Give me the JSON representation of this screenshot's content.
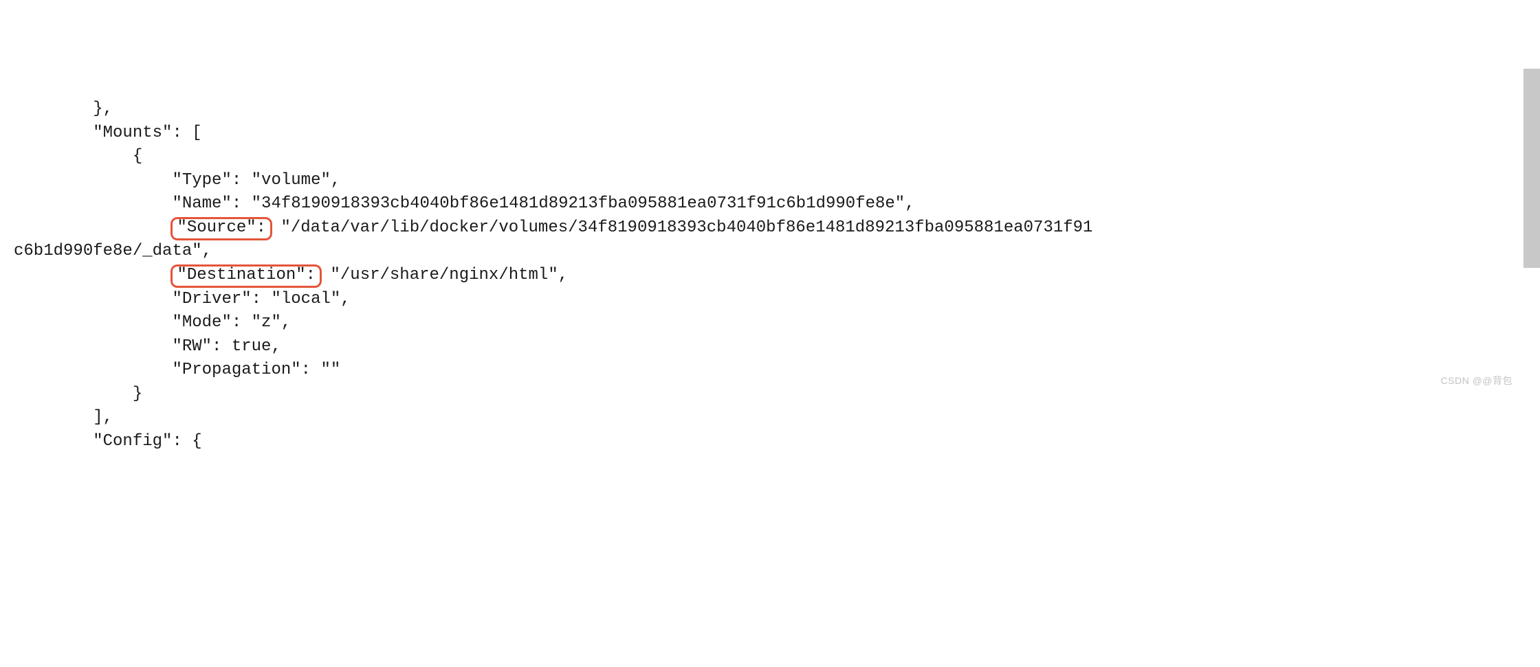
{
  "code": {
    "l1": "        },",
    "l2": "        \"Mounts\": [",
    "l3": "            {",
    "l4": "                \"Type\": \"volume\",",
    "l5a": "                \"Name\": \"34f8190918393cb4040bf86e1481d89213fba095881ea0731f91c6b1d990fe8e\",",
    "l6_key": "\"Source\":",
    "l6_val": " \"/data/var/lib/docker/volumes/34f8190918393cb4040bf86e1481d89213fba095881ea0731f91",
    "l6_wrap": "c6b1d990fe8e/_data\",",
    "l7_key": "\"Destination\":",
    "l7_val": " \"/usr/share/nginx/html\",",
    "l8": "                \"Driver\": \"local\",",
    "l9": "                \"Mode\": \"z\",",
    "l10": "                \"RW\": true,",
    "l11": "                \"Propagation\": \"\"",
    "l12": "            }",
    "l13": "        ],",
    "l14": "        \"Config\": {",
    "indent16": "                "
  },
  "watermark": "CSDN @@背包"
}
